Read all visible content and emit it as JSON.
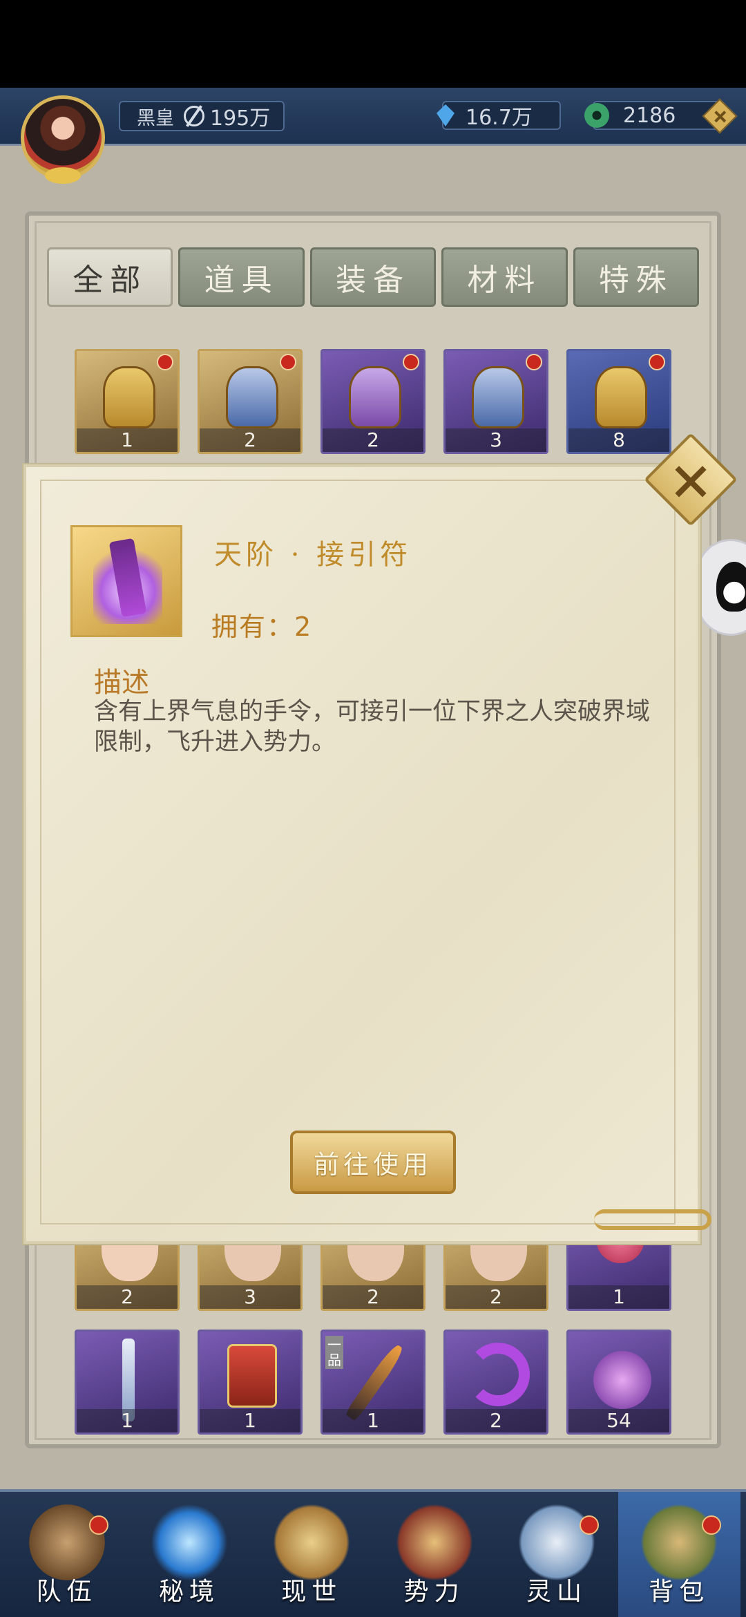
{
  "header": {
    "player_name": "黑皇",
    "power": "195万",
    "crystal_amount": "16.7万",
    "jade_amount": "2186"
  },
  "tabs": [
    {
      "label": "全部",
      "active": true
    },
    {
      "label": "道具",
      "active": false
    },
    {
      "label": "装备",
      "active": false
    },
    {
      "label": "材料",
      "active": false
    },
    {
      "label": "特殊",
      "active": false
    }
  ],
  "grid": {
    "row1": [
      {
        "icon": "pouch-icon",
        "rarity": "gold",
        "count": "1",
        "new": true
      },
      {
        "icon": "pouch-icon",
        "rarity": "gold",
        "count": "2",
        "new": true
      },
      {
        "icon": "pouch-icon",
        "rarity": "purple",
        "count": "2",
        "new": true
      },
      {
        "icon": "pouch-icon",
        "rarity": "purple",
        "count": "3",
        "new": true
      },
      {
        "icon": "pouch-icon",
        "rarity": "blue",
        "count": "8",
        "new": true
      }
    ],
    "row5": [
      {
        "icon": "portrait-icon",
        "count": "2"
      },
      {
        "icon": "portrait-icon",
        "count": "3"
      },
      {
        "icon": "portrait-icon",
        "count": "2"
      },
      {
        "icon": "portrait-icon",
        "count": "2"
      },
      {
        "icon": "flower-icon",
        "count": "1"
      }
    ],
    "row6": [
      {
        "icon": "sword-icon",
        "count": "1"
      },
      {
        "icon": "token-icon",
        "count": "1"
      },
      {
        "icon": "blade-icon",
        "count": "1",
        "tag": "一品"
      },
      {
        "icon": "crescent-icon",
        "count": "2"
      },
      {
        "icon": "orb-icon",
        "count": "54"
      }
    ]
  },
  "popup": {
    "item_name": "天阶 · 接引符",
    "owned": "拥有：2",
    "desc_title": "描述",
    "desc_text": "含有上界气息的手令，可接引一位下界之人突破界域限制，飞升进入势力。",
    "use_button": "前往使用"
  },
  "bottom_nav": [
    {
      "label": "队伍",
      "icon": "team-icon",
      "badge": true
    },
    {
      "label": "秘境",
      "icon": "portal-icon",
      "badge": false
    },
    {
      "label": "现世",
      "icon": "scroll-icon",
      "badge": false
    },
    {
      "label": "势力",
      "icon": "palace-icon",
      "badge": false
    },
    {
      "label": "灵山",
      "icon": "mountain-icon",
      "badge": true
    },
    {
      "label": "背包",
      "icon": "bag-icon",
      "badge": true,
      "active": true
    }
  ]
}
